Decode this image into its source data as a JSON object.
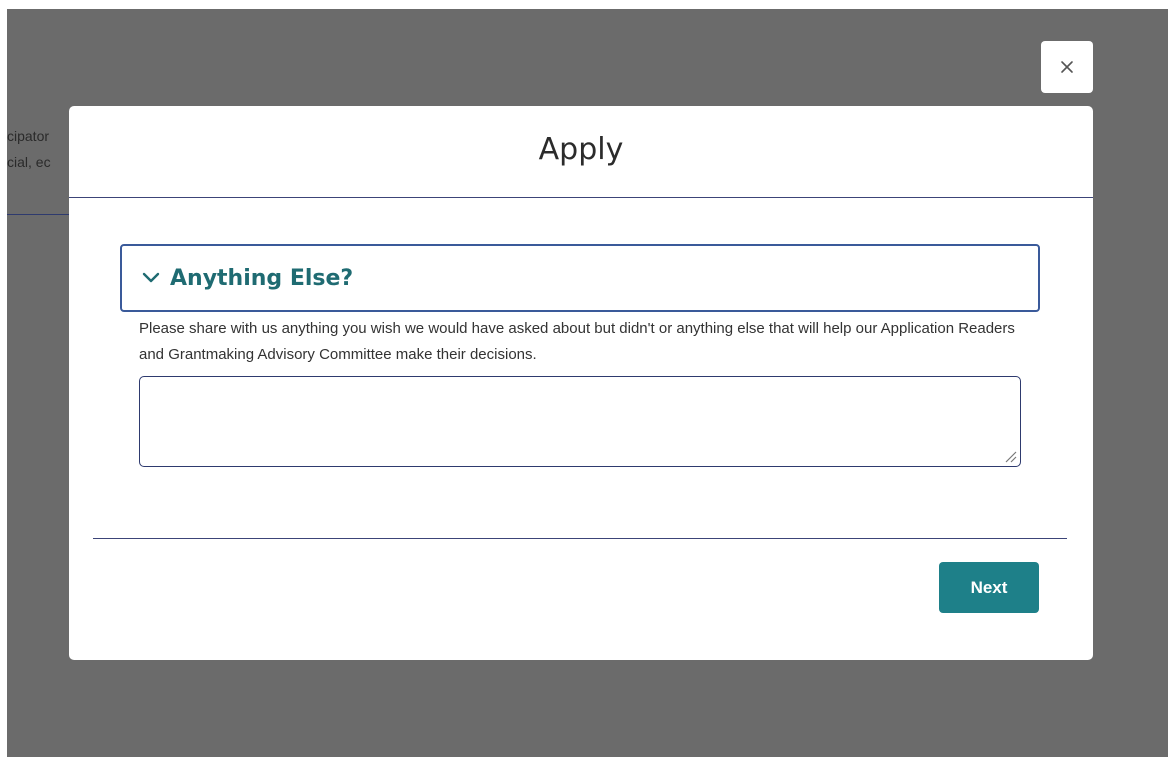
{
  "background": {
    "text_lines": [
      "cipator",
      "cial, ec"
    ]
  },
  "modal": {
    "title": "Apply",
    "close_icon": "close-icon",
    "section": {
      "title": "Anything Else?",
      "toggle_icon": "chevron-down-icon",
      "expanded": true
    },
    "help_text": "Please share with us anything you wish we would have asked about but didn't or anything else that will help our Application Readers and Grantmaking Advisory Committee make their decisions.",
    "response": {
      "value": "",
      "placeholder": ""
    },
    "next_label": "Next"
  },
  "colors": {
    "overlay": "#6b6b6b",
    "accent": "#1e8089",
    "section_title": "#1f6b72",
    "border": "#3c4478"
  }
}
